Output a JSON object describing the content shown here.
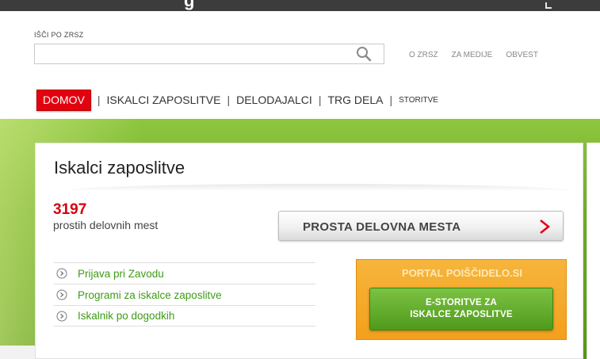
{
  "search": {
    "label": "IŠČI PO ZRSZ",
    "value": "",
    "placeholder": ""
  },
  "util_nav": [
    "O ZRSZ",
    "ZA MEDIJE",
    "OBVEST"
  ],
  "main_nav": {
    "items": [
      "DOMOV",
      "ISKALCI ZAPOSLITVE",
      "DELODAJALCI",
      "TRG DELA",
      "STORITVE"
    ],
    "separator": "|",
    "active": "DOMOV"
  },
  "card": {
    "title": "Iskalci zaposlitve",
    "count": "3197",
    "count_label": "prostih delovnih mest",
    "jobs_button": "PROSTA DELOVNA MESTA",
    "links": [
      "Prijava pri Zavodu",
      "Programi za iskalce zaposlitve",
      "Iskalnik po dogodkih"
    ]
  },
  "portal": {
    "title": "PORTAL POIŠČIDELO.SI",
    "button_line1": "E-STORITVE ZA",
    "button_line2": "ISKALCE ZAPOSLITVE"
  },
  "icons": {
    "search": "search-icon",
    "chevron": "chevron-right-icon",
    "link": "circle-arrow-icon"
  },
  "colors": {
    "brand_red": "#e3000f",
    "link_green": "#3f9b17",
    "band_green": "#6fad22",
    "portal_orange": "#f3a01c"
  }
}
